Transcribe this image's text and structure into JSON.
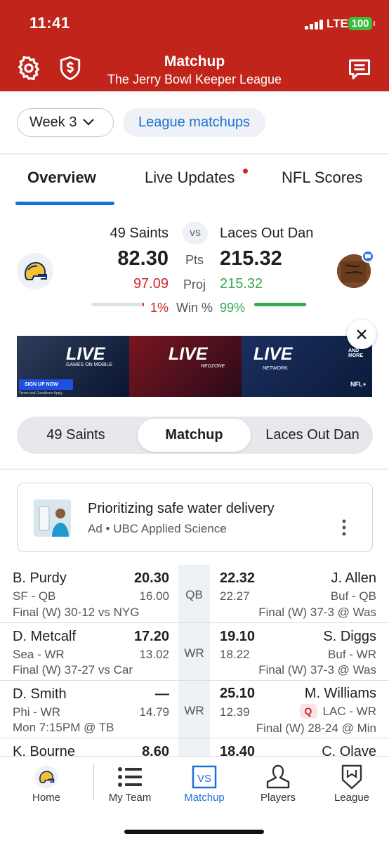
{
  "status_bar": {
    "time": "11:41",
    "network": "LTE",
    "battery": "100"
  },
  "header": {
    "title": "Matchup",
    "subtitle": "The Jerry Bowl Keeper League",
    "left_icons": [
      "gear-icon",
      "shield-dollar-icon"
    ],
    "right_icon": "chat-icon"
  },
  "controls": {
    "week_label": "Week 3",
    "league_matchups_label": "League matchups"
  },
  "tabs": [
    {
      "label": "Overview",
      "active": true
    },
    {
      "label": "Live Updates",
      "active": false,
      "badge": true
    },
    {
      "label": "NFL Scores",
      "active": false
    }
  ],
  "scoreboard": {
    "vs_label": "vs",
    "pts_label": "Pts",
    "proj_label": "Proj",
    "win_label": "Win %",
    "left": {
      "name": "49 Saints",
      "pts": "82.30",
      "proj": "97.09",
      "win": "1%",
      "win_fraction": 0.01
    },
    "right": {
      "name": "Laces Out Dan",
      "pts": "215.32",
      "proj": "215.32",
      "win": "99%",
      "win_fraction": 0.99
    }
  },
  "banner_ad": {
    "live_labels": [
      "LIVE",
      "LIVE",
      "LIVE"
    ],
    "sub_labels": [
      "GAMES ON MOBILE",
      "REDZONE",
      "NETWORK"
    ],
    "cta": "SIGN UP NOW",
    "more": "AND MORE",
    "brand": "NFL+",
    "fine_print": "Terms and Conditions Apply."
  },
  "segment": {
    "items": [
      "49 Saints",
      "Matchup",
      "Laces Out Dan"
    ],
    "active_index": 1
  },
  "sponsored": {
    "title": "Prioritizing safe water delivery",
    "sub": "Ad • UBC Applied Science"
  },
  "rows": [
    {
      "pos": "QB",
      "left": {
        "name": "B. Purdy",
        "pts": "20.30",
        "team": "SF - QB",
        "proj": "16.00",
        "game": "Final (W) 30-12 vs NYG"
      },
      "right": {
        "name": "J. Allen",
        "pts": "22.32",
        "team": "Buf - QB",
        "proj": "22.27",
        "game": "Final (W) 37-3 @ Was"
      }
    },
    {
      "pos": "WR",
      "left": {
        "name": "D. Metcalf",
        "pts": "17.20",
        "team": "Sea - WR",
        "proj": "13.02",
        "game": "Final (W) 37-27 vs Car"
      },
      "right": {
        "name": "S. Diggs",
        "pts": "19.10",
        "team": "Buf - WR",
        "proj": "18.22",
        "game": "Final (W) 37-3 @ Was"
      }
    },
    {
      "pos": "WR",
      "left": {
        "name": "D. Smith",
        "pts": "—",
        "team": "Phi - WR",
        "proj": "14.79",
        "game": "Mon 7:15PM @ TB"
      },
      "right": {
        "name": "M. Williams",
        "pts": "25.10",
        "team": "LAC - WR",
        "proj": "12.39",
        "game": "Final (W) 28-24 @ Min",
        "status": "Q"
      }
    },
    {
      "pos": "",
      "left": {
        "name": "K. Bourne",
        "pts": "8.60"
      },
      "right": {
        "name": "C. Olave",
        "pts": "18.40"
      }
    }
  ],
  "bottom_nav": [
    {
      "label": "Home",
      "icon": "helmet-icon"
    },
    {
      "label": "My Team",
      "icon": "list-icon"
    },
    {
      "label": "Matchup",
      "icon": "vs-icon",
      "active": true
    },
    {
      "label": "Players",
      "icon": "player-icon"
    },
    {
      "label": "League",
      "icon": "league-shield-icon"
    }
  ],
  "colors": {
    "header": "#c0241b",
    "accent": "#1d6fd6",
    "loss": "#d0262c",
    "win": "#34a853"
  }
}
